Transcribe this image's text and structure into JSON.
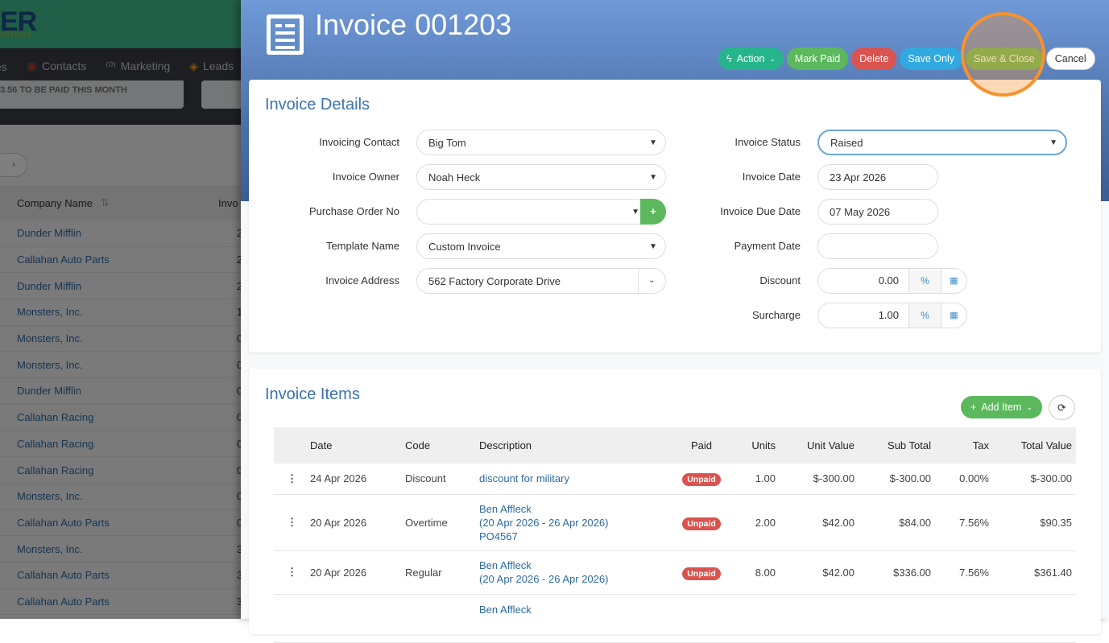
{
  "background": {
    "logo": "ER",
    "logo_sub": "UTIONS",
    "nav": [
      {
        "icon": "",
        "label": "es"
      },
      {
        "icon": "contacts-icon",
        "label": "Contacts"
      },
      {
        "icon": "marketing-icon",
        "label": "Marketing"
      },
      {
        "icon": "leads-icon",
        "label": "Leads"
      }
    ],
    "paid_banner": "3.56 TO BE PAID THIS MONTH",
    "pager_next": "›",
    "columns": [
      "Company Name",
      "Invo"
    ],
    "sort_icon": "⇅",
    "rows": [
      [
        "Dunder Mifflin",
        "2"
      ],
      [
        "Callahan Auto Parts",
        "2"
      ],
      [
        "Dunder Mifflin",
        "2"
      ],
      [
        "Monsters, Inc.",
        "1"
      ],
      [
        "Monsters, Inc.",
        "0"
      ],
      [
        "Monsters, Inc.",
        "0"
      ],
      [
        "Dunder Mifflin",
        "0"
      ],
      [
        "Callahan Racing",
        "0"
      ],
      [
        "Callahan Racing",
        "0"
      ],
      [
        "Callahan Racing",
        "0"
      ],
      [
        "Monsters, Inc.",
        "0"
      ],
      [
        "Callahan Auto Parts",
        "0"
      ],
      [
        "Monsters, Inc.",
        "3"
      ],
      [
        "Callahan Auto Parts",
        "3"
      ],
      [
        "Callahan Auto Parts",
        "3"
      ]
    ]
  },
  "header": {
    "title": "Invoice 001203",
    "buttons": {
      "action": "Action",
      "mark_paid": "Mark Paid",
      "delete": "Delete",
      "save_only": "Save Only",
      "save_close": "Save & Close",
      "cancel": "Cancel"
    }
  },
  "details": {
    "title": "Invoice Details",
    "invoicing_contact": {
      "label": "Invoicing Contact",
      "value": "Big Tom"
    },
    "invoice_owner": {
      "label": "Invoice Owner",
      "value": "Noah Heck"
    },
    "purchase_order": {
      "label": "Purchase Order No",
      "value": ""
    },
    "template_name": {
      "label": "Template Name",
      "value": "Custom Invoice"
    },
    "invoice_address": {
      "label": "Invoice Address",
      "value": "562 Factory Corporate Drive"
    },
    "invoice_status": {
      "label": "Invoice Status",
      "value": "Raised"
    },
    "invoice_date": {
      "label": "Invoice Date",
      "value": "23 Apr 2026"
    },
    "due_date": {
      "label": "Invoice Due Date",
      "value": "07 May 2026"
    },
    "payment_date": {
      "label": "Payment Date",
      "value": ""
    },
    "discount": {
      "label": "Discount",
      "value": "0.00",
      "unit": "%"
    },
    "surcharge": {
      "label": "Surcharge",
      "value": "1.00",
      "unit": "%"
    }
  },
  "items": {
    "title": "Invoice Items",
    "add_item": "Add Item",
    "columns": [
      "Date",
      "Code",
      "Description",
      "Paid",
      "Units",
      "Unit Value",
      "Sub Total",
      "Tax",
      "Total Value"
    ],
    "rows": [
      {
        "date": "24 Apr 2026",
        "code": "Discount",
        "desc": [
          "discount for military"
        ],
        "paid": "Unpaid",
        "units": "1.00",
        "unit_value": "$-300.00",
        "sub_total": "$-300.00",
        "tax": "0.00%",
        "total": "$-300.00"
      },
      {
        "date": "20 Apr 2026",
        "code": "Overtime",
        "desc": [
          "Ben Affleck",
          "(20 Apr 2026 - 26 Apr 2026)",
          "PO4567"
        ],
        "paid": "Unpaid",
        "units": "2.00",
        "unit_value": "$42.00",
        "sub_total": "$84.00",
        "tax": "7.56%",
        "total": "$90.35"
      },
      {
        "date": "20 Apr 2026",
        "code": "Regular",
        "desc": [
          "Ben Affleck",
          "(20 Apr 2026 - 26 Apr 2026)"
        ],
        "paid": "Unpaid",
        "units": "8.00",
        "unit_value": "$42.00",
        "sub_total": "$336.00",
        "tax": "7.56%",
        "total": "$361.40"
      },
      {
        "desc": [
          "Ben Affleck"
        ]
      }
    ]
  }
}
